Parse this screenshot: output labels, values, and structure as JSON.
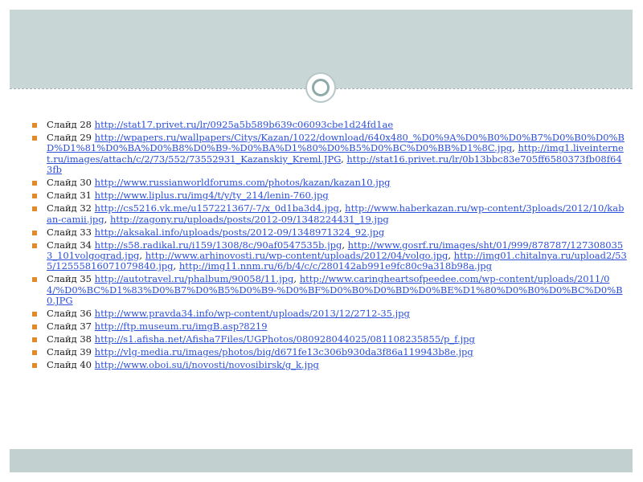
{
  "slides": [
    {
      "label": "Слайд 28",
      "links": [
        "http://stat17.privet.ru/lr/0925a5b589b639c06093cbe1d24fd1ae"
      ]
    },
    {
      "label": "Слайд 29",
      "links": [
        "http://wpapers.ru/wallpapers/Citys/Kazan/1022/download/640x480_%D0%9A%D0%B0%D0%B7%D0%B0%D0%BD%D1%81%D0%BA%D0%B8%D0%B9-%D0%BA%D1%80%D0%B5%D0%BC%D0%BB%D1%8C.jpg",
        "http://img1.liveinternet.ru/images/attach/c/2/73/552/73552931_Kazanskiy_Kreml.JPG",
        "http://stat16.privet.ru/lr/0b13bbc83e705ff6580373fb08f643fb"
      ]
    },
    {
      "label": "Слайд 30",
      "links": [
        "http://www.russianworldforums.com/photos/kazan/kazan10.jpg"
      ]
    },
    {
      "label": "Слайд 31",
      "links": [
        "http://www.liplus.ru/img4/t/y/ty_214/lenin-760.jpg"
      ]
    },
    {
      "label": "Слайд 32",
      "links": [
        "http://cs5216.vk.me/u157221367/-7/x_0d1ba3d4.jpg",
        "http://www.haberkazan.ru/wp-content/3ploads/2012/10/kaban-camii.jpg",
        "http://zagony.ru/uploads/posts/2012-09/1348224431_19.jpg"
      ]
    },
    {
      "label": "Слайд 33",
      "links": [
        "http://aksakal.info/uploads/posts/2012-09/1348971324_92.jpg"
      ]
    },
    {
      "label": "Слайд 34",
      "links": [
        "http://s58.radikal.ru/i159/1308/8c/90af0547535b.jpg",
        "http://www.gosrf.ru/images/sht/01/999/878787/1273080353_101volgograd.jpg",
        "http://www.arhinovosti.ru/wp-content/uploads/2012/04/volgo.jpg",
        "http://img01.chitalnya.ru/upload2/535/12555816071079840.jpg",
        "http://img11.nnm.ru/6/b/4/c/c/280142ab991e9fc80c9a318b98a.jpg"
      ]
    },
    {
      "label": "Слайд 35",
      "links": [
        "http://autotravel.ru/phalbum/90058/11.jpg",
        "http://www.caringheartsofpeedee.com/wp-content/uploads/2011/04/%D0%BC%D1%83%D0%B7%D0%B5%D0%B9-%D0%BF%D0%B0%D0%BD%D0%BE%D1%80%D0%B0%D0%BC%D0%B0.JPG"
      ]
    },
    {
      "label": "Слайд 36",
      "links": [
        "http://www.pravda34.info/wp-content/uploads/2013/12/2712-35.jpg"
      ]
    },
    {
      "label": "Слайд 37",
      "links": [
        "http://ftp.museum.ru/imgB.asp?8219"
      ]
    },
    {
      "label": "Слайд 38",
      "links": [
        "http://s1.afisha.net/Afisha7Files/UGPhotos/080928044025/081108235855/p_f.jpg"
      ]
    },
    {
      "label": "Слайд 39",
      "links": [
        "http://vlg-media.ru/images/photos/big/d671fe13c306b930da3f86a119943b8e.jpg"
      ]
    },
    {
      "label": "Слайд 40",
      "links": [
        "http://www.oboi.su/i/novosti/novosibirsk/g_k.jpg"
      ]
    }
  ],
  "colors": {
    "band": "#c9d6d6",
    "bullet": "#e08a2c",
    "link": "#2b4fd8",
    "ring": "#8fa9a9"
  },
  "icons": {
    "bullet": "square-bullet-icon",
    "ornament": "ring-ornament-icon"
  }
}
